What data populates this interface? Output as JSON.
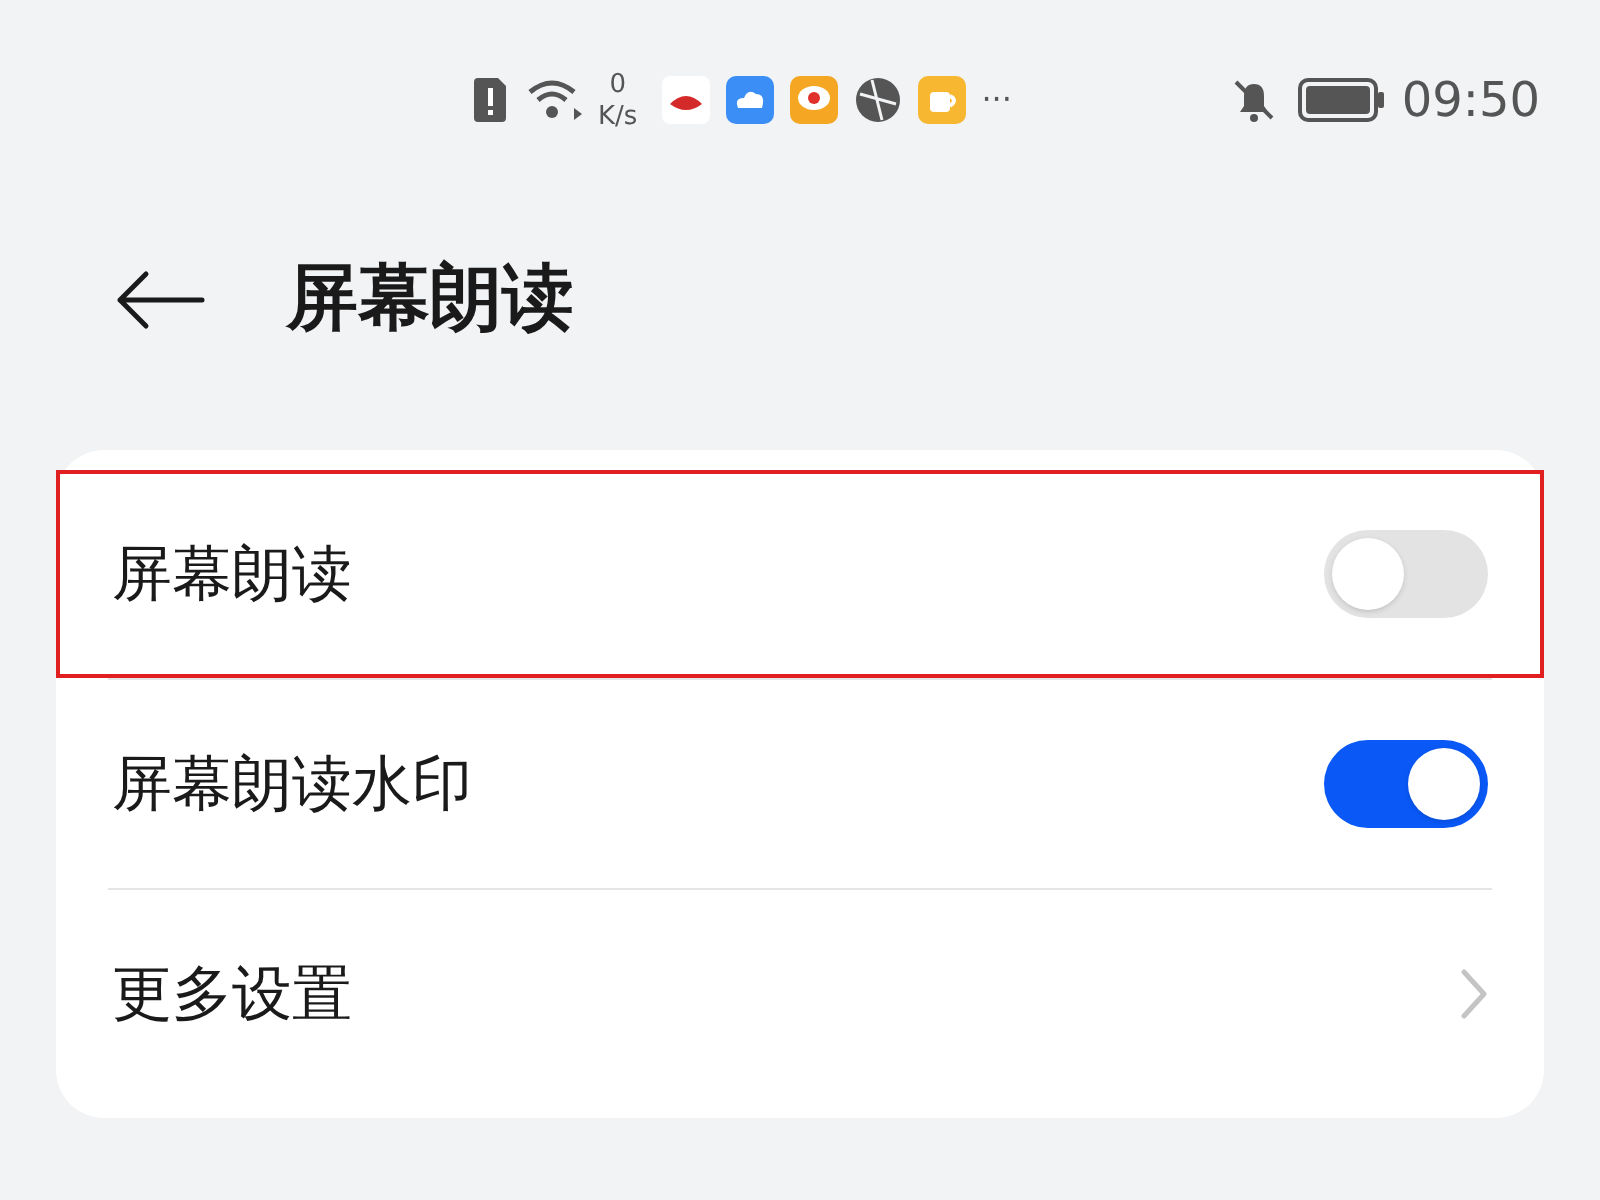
{
  "status_bar": {
    "speed_value": "0",
    "speed_unit": "K/s",
    "more": "···",
    "time": "09:50"
  },
  "header": {
    "title": "屏幕朗读"
  },
  "settings": [
    {
      "kind": "switch",
      "label": "屏幕朗读",
      "on": false,
      "highlighted": true
    },
    {
      "kind": "switch",
      "label": "屏幕朗读水印",
      "on": true,
      "highlighted": false
    },
    {
      "kind": "link",
      "label": "更多设置",
      "highlighted": false
    }
  ]
}
